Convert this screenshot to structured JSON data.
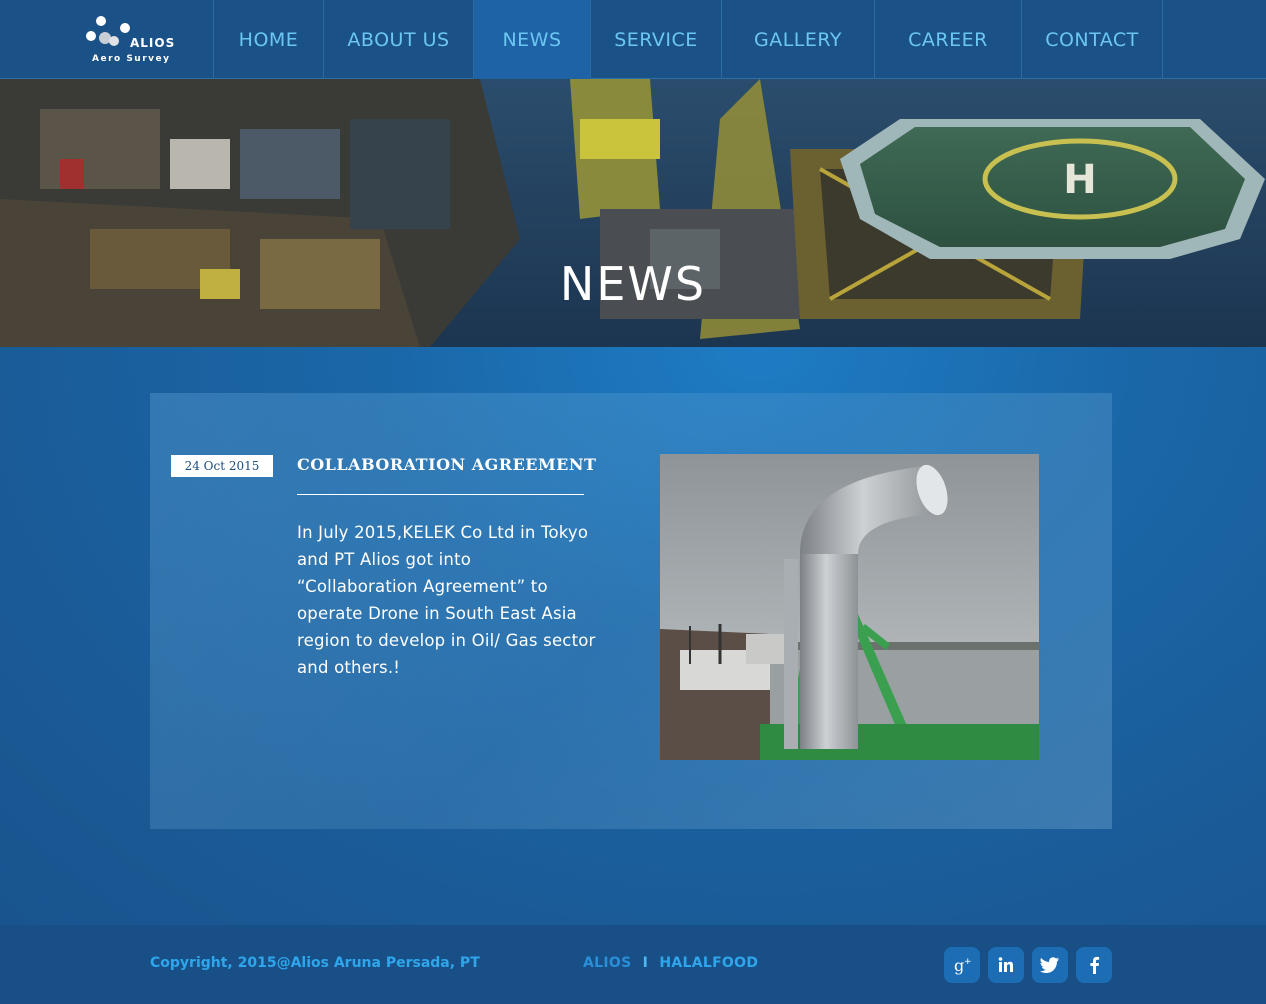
{
  "brand": {
    "name": "ALIOS",
    "tagline": "Aero Survey"
  },
  "nav": {
    "items": [
      {
        "label": "HOME",
        "active": false
      },
      {
        "label": "ABOUT US",
        "active": false
      },
      {
        "label": "NEWS",
        "active": true
      },
      {
        "label": "SERVICE",
        "active": false
      },
      {
        "label": "GALLERY",
        "active": false
      },
      {
        "label": "CAREER",
        "active": false
      },
      {
        "label": "CONTACT",
        "active": false
      }
    ]
  },
  "hero": {
    "title": "NEWS"
  },
  "article": {
    "date": "24 Oct 2015",
    "title": "COLLABORATION AGREEMENT",
    "body": "In July 2015,KELEK Co Ltd in Tokyo and PT Alios got into “Collaboration Agreement” to operate Drone in South East Asia region to develop in Oil/ Gas sector and others.!"
  },
  "footer": {
    "copyright": "Copyright, 2015@Alios Aruna Persada, PT",
    "link_alios": "ALIOS",
    "separator": "I",
    "link_halalfood": "HALALFOOD",
    "socials": [
      "google-plus-icon",
      "linkedin-icon",
      "twitter-icon",
      "facebook-icon"
    ]
  },
  "colors": {
    "nav_bg": "#1a5288",
    "nav_text": "#6cc6f2",
    "nav_active": "#1d63a6",
    "accent": "#2fa6ec",
    "main_bg": "#1a5f98",
    "footer_bg": "#184f86",
    "social_bg": "#1d6db5"
  }
}
